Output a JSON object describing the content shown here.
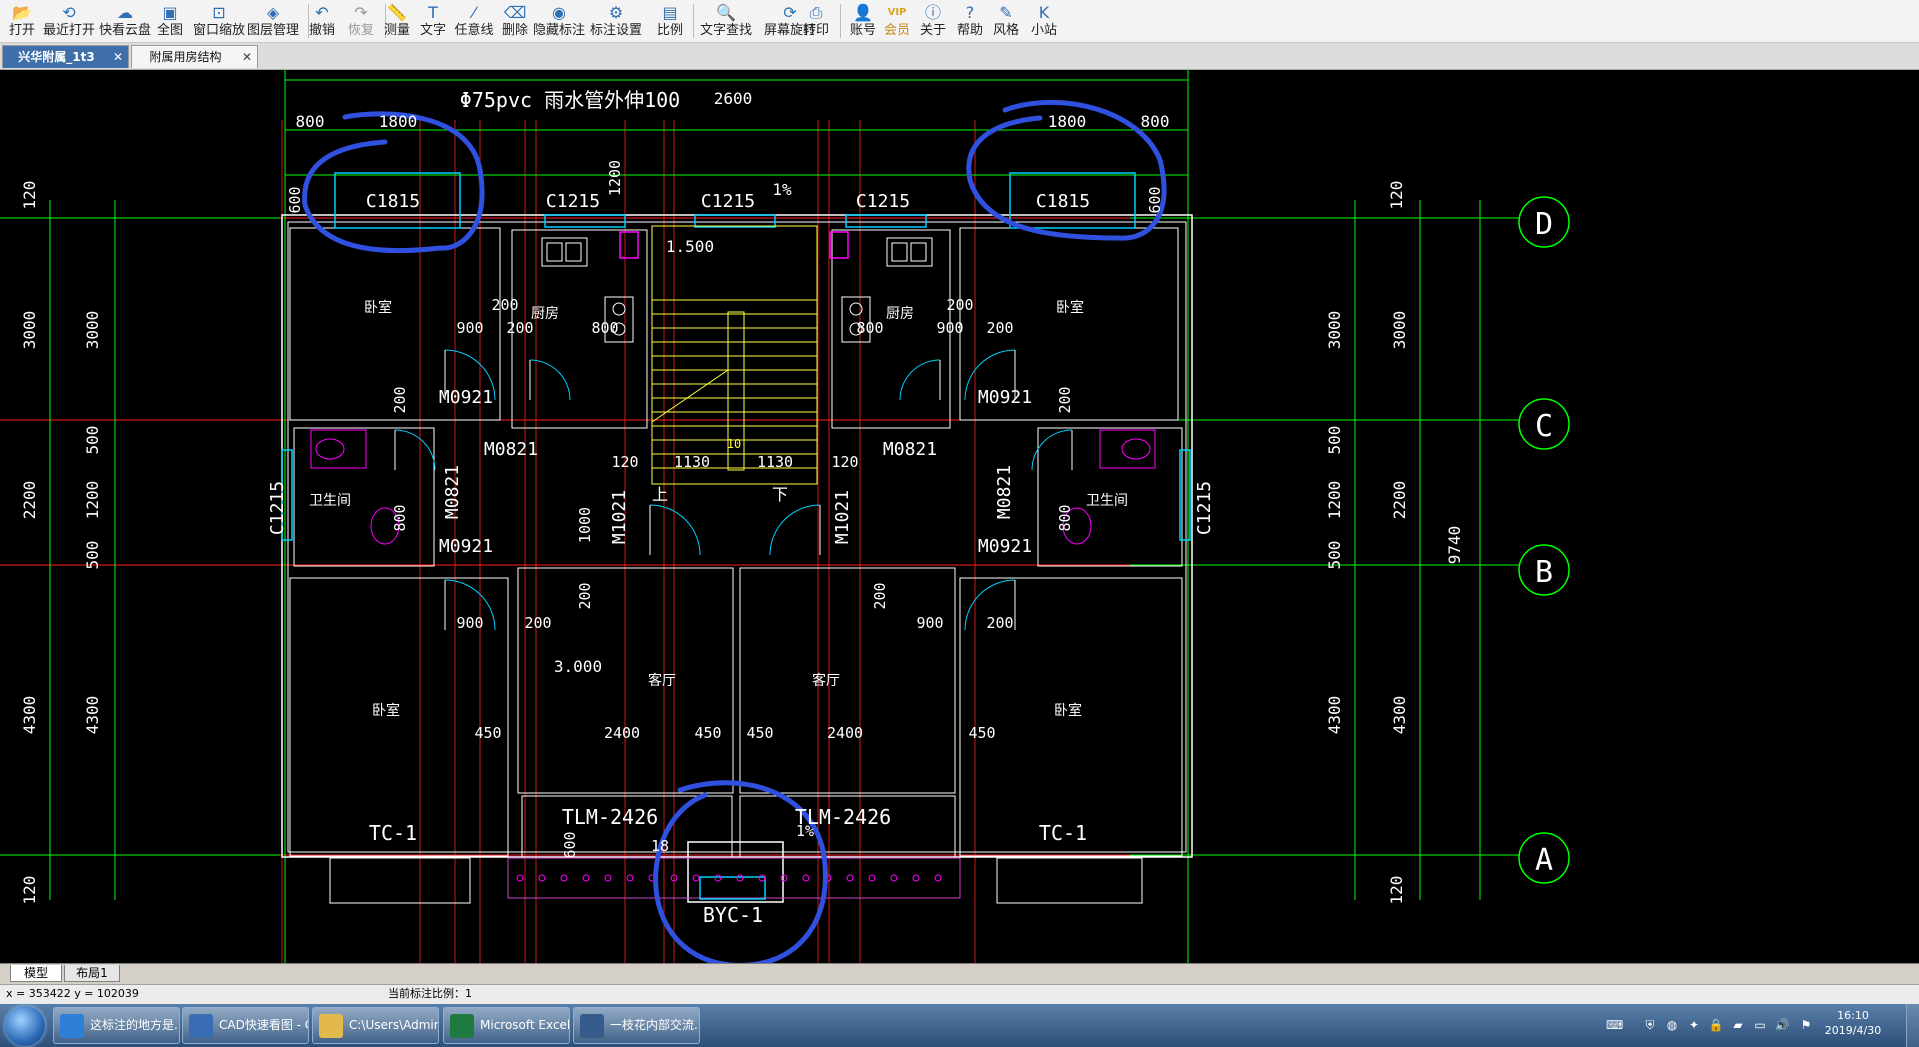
{
  "toolbar": {
    "buttons": [
      {
        "label": "打开",
        "icon": "open-folder-icon",
        "glyph": "📂"
      },
      {
        "label": "最近打开",
        "icon": "recent-icon",
        "glyph": "⟲"
      },
      {
        "label": "快看云盘",
        "icon": "cloud-icon",
        "glyph": "☁"
      },
      {
        "label": "全图",
        "icon": "full-view-icon",
        "glyph": "▣"
      },
      {
        "label": "窗口缩放",
        "icon": "window-zoom-icon",
        "glyph": "⊡"
      },
      {
        "label": "图层管理",
        "icon": "layers-icon",
        "glyph": "◈"
      },
      {
        "label": "撤销",
        "icon": "undo-icon",
        "glyph": "↶"
      },
      {
        "label": "恢复",
        "icon": "redo-icon",
        "glyph": "↷"
      },
      {
        "label": "测量",
        "icon": "measure-icon",
        "glyph": "📏"
      },
      {
        "label": "文字",
        "icon": "text-icon",
        "glyph": "T"
      },
      {
        "label": "任意线",
        "icon": "line-icon",
        "glyph": "⁄"
      },
      {
        "label": "删除",
        "icon": "eraser-icon",
        "glyph": "⌫"
      },
      {
        "label": "隐藏标注",
        "icon": "hide-annotation-icon",
        "glyph": "◉"
      },
      {
        "label": "标注设置",
        "icon": "annotation-settings-icon",
        "glyph": "⚙"
      },
      {
        "label": "比例",
        "icon": "scale-icon",
        "glyph": "▤"
      },
      {
        "label": "文字查找",
        "icon": "text-search-icon",
        "glyph": "🔍"
      },
      {
        "label": "屏幕旋转",
        "icon": "rotate-screen-icon",
        "glyph": "⟳"
      },
      {
        "label": "打印",
        "icon": "print-icon",
        "glyph": "⎙"
      },
      {
        "label": "账号",
        "icon": "account-icon",
        "glyph": "👤"
      },
      {
        "label": "会员",
        "icon": "vip-icon",
        "glyph": "VIP"
      },
      {
        "label": "关于",
        "icon": "about-icon",
        "glyph": "ⓘ"
      },
      {
        "label": "帮助",
        "icon": "help-icon",
        "glyph": "?"
      },
      {
        "label": "风格",
        "icon": "style-icon",
        "glyph": "✎"
      },
      {
        "label": "小站",
        "icon": "kuaikan-site-icon",
        "glyph": "K"
      }
    ]
  },
  "tabs": [
    {
      "label": "兴华附属_1t3",
      "active": true
    },
    {
      "label": "附属用房结构",
      "active": false
    }
  ],
  "drawing": {
    "note": "Φ75pvc 雨水管外伸100",
    "window_labels": [
      "C1815",
      "C1215",
      "C1215",
      "C1215",
      "C1815",
      "C1215",
      "C1215"
    ],
    "door_labels": [
      "M0921",
      "M0821",
      "M0821",
      "M0921",
      "M0821",
      "M0821",
      "M0921",
      "M0921",
      "M1021",
      "M1021"
    ],
    "rooms": [
      "卧室",
      "厨房",
      "厨房",
      "卧室",
      "卫生间",
      "卫生间",
      "卧室",
      "客厅",
      "客厅",
      "卧室"
    ],
    "balcony": [
      "TC-1",
      "TC-1",
      "TLM-2426",
      "TLM-2426",
      "BYC-1"
    ],
    "levels": [
      "1.500",
      "3.000"
    ],
    "slope": "1%",
    "dims_top": [
      "800",
      "1800",
      "2600",
      "1800",
      "800"
    ],
    "dims_left_outer": [
      "120",
      "3000",
      "2200",
      "4300",
      "120"
    ],
    "dims_left_inner": [
      "3000",
      "500",
      "1200",
      "500",
      "4300"
    ],
    "dims_right_inner": [
      "120",
      "3000",
      "500",
      "1200",
      "500",
      "4300",
      "120"
    ],
    "dims_right_outer": [
      "3000",
      "2200",
      "4300"
    ],
    "dims_total": "9740",
    "dims_misc": [
      "600",
      "1200",
      "600",
      "200",
      "900",
      "200",
      "800",
      "800",
      "200",
      "900",
      "200",
      "200",
      "200",
      "120",
      "1130",
      "1130",
      "120",
      "800",
      "800",
      "1000",
      "200",
      "200",
      "900",
      "200",
      "200",
      "900",
      "450",
      "2400",
      "450",
      "450",
      "2400",
      "450",
      "600",
      "18",
      "1%"
    ],
    "axis_labels": [
      "D",
      "C",
      "B",
      "A"
    ],
    "stair_words": [
      "上",
      "下",
      "10"
    ]
  },
  "layout_tabs": [
    {
      "label": "模型",
      "active": true
    },
    {
      "label": "布局1",
      "active": false
    }
  ],
  "status": {
    "coords": "x = 353422  y = 102039",
    "scale": "当前标注比例：1"
  },
  "taskbar": {
    "items": [
      {
        "label": "这标注的地方是...",
        "icon": "ie-icon",
        "color": "#2d7fd8"
      },
      {
        "label": "CAD快速看图 - C...",
        "icon": "cad-icon",
        "color": "#3a6db4"
      },
      {
        "label": "C:\\Users\\Admini...",
        "icon": "folder-icon",
        "color": "#e2b94a"
      },
      {
        "label": "Microsoft Excel ...",
        "icon": "excel-icon",
        "color": "#1e7a3e"
      },
      {
        "label": "一枝花内部交流...",
        "icon": "graduation-cap-icon",
        "color": "#355c8a"
      }
    ],
    "clock_time": "16:10",
    "clock_date": "2019/4/30"
  },
  "colors": {
    "wall": "#ffffff",
    "axis": "#ff2020",
    "dim": "#00ff00",
    "window": "#00cfff",
    "fixture": "#ff00ff",
    "stair": "#ffff40",
    "markup": "#3050e0"
  }
}
